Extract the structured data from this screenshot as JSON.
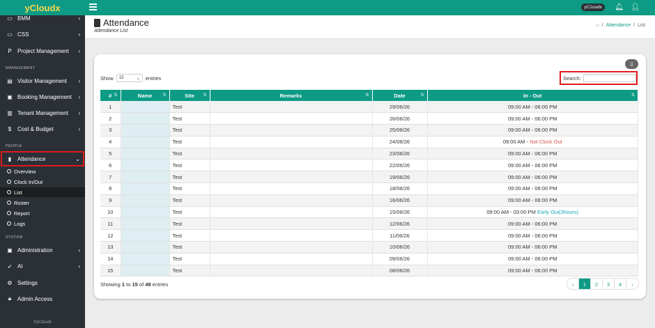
{
  "brand": "yCloudx",
  "sidebar": {
    "top_items": [
      {
        "label": "BMM",
        "icon": "monitor-icon"
      },
      {
        "label": "CSS",
        "icon": "monitor-icon"
      },
      {
        "label": "Project Management",
        "icon": "p-icon"
      }
    ],
    "management_label": "MANAGEMENT",
    "management_items": [
      {
        "label": "Visitor Management",
        "icon": "id-card-icon"
      },
      {
        "label": "Booking Management",
        "icon": "briefcase-icon"
      },
      {
        "label": "Tenant Management",
        "icon": "tenant-icon"
      },
      {
        "label": "Cost & Budget",
        "icon": "dollar-icon"
      }
    ],
    "people_label": "PEOPLE",
    "attendance_label": "Attendance",
    "attendance_sub": [
      "Overview",
      "Clock In/Out",
      "List",
      "Roster",
      "Report",
      "Logs"
    ],
    "system_label": "SYSTEM",
    "system_items": [
      {
        "label": "Administration",
        "icon": "briefcase-icon"
      },
      {
        "label": "AI",
        "icon": "rocket-icon"
      },
      {
        "label": "Settings",
        "icon": "gear-icon"
      },
      {
        "label": "Admin Access",
        "icon": "lock-icon"
      }
    ],
    "footer": "©yCloudx"
  },
  "topbar": {
    "user": "yC1oudx"
  },
  "header": {
    "title": "Attendance",
    "subtitle": "Attendance List",
    "breadcrumb": [
      "Attendance",
      "List"
    ]
  },
  "controls": {
    "show_label": "Show",
    "page_size": "15",
    "entries_label": "entries",
    "search_label": "Search:"
  },
  "table": {
    "columns": [
      "#",
      "Name",
      "Site",
      "Remarks",
      "Date",
      "In - Out"
    ],
    "rows": [
      {
        "n": "1",
        "site": "Test",
        "date": "29/06/26",
        "time": "09:00 AM - 06:00 PM",
        "note": ""
      },
      {
        "n": "2",
        "site": "Test",
        "date": "26/06/26",
        "time": "09:00 AM - 06:00 PM",
        "note": ""
      },
      {
        "n": "3",
        "site": "Test",
        "date": "25/06/26",
        "time": "09:00 AM - 06:00 PM",
        "note": ""
      },
      {
        "n": "4",
        "site": "Test",
        "date": "24/06/26",
        "time": "09:00 AM - ",
        "note": "Not Clock Out",
        "note_color": "red"
      },
      {
        "n": "5",
        "site": "Test",
        "date": "23/06/26",
        "time": "09:00 AM - 06:00 PM",
        "note": ""
      },
      {
        "n": "6",
        "site": "Test",
        "date": "22/06/26",
        "time": "09:00 AM - 06:00 PM",
        "note": ""
      },
      {
        "n": "7",
        "site": "Test",
        "date": "19/06/26",
        "time": "09:00 AM - 06:00 PM",
        "note": ""
      },
      {
        "n": "8",
        "site": "Test",
        "date": "18/06/26",
        "time": "09:00 AM - 08:00 PM",
        "note": ""
      },
      {
        "n": "9",
        "site": "Test",
        "date": "16/06/26",
        "time": "09:00 AM - 06:00 PM",
        "note": ""
      },
      {
        "n": "10",
        "site": "Test",
        "date": "15/06/26",
        "time": "09:00 AM - 03:00 PM ",
        "note": "Early Out(3hours)",
        "note_color": "teal"
      },
      {
        "n": "11",
        "site": "Test",
        "date": "12/06/26",
        "time": "09:00 AM - 06:00 PM",
        "note": ""
      },
      {
        "n": "12",
        "site": "Test",
        "date": "11/06/26",
        "time": "09:00 AM - 06:00 PM",
        "note": ""
      },
      {
        "n": "13",
        "site": "Test",
        "date": "10/06/26",
        "time": "09:00 AM - 06:00 PM",
        "note": ""
      },
      {
        "n": "14",
        "site": "Test",
        "date": "09/06/26",
        "time": "09:00 AM - 06:00 PM",
        "note": ""
      },
      {
        "n": "15",
        "site": "Test",
        "date": "08/06/26",
        "time": "09:00 AM - 06:00 PM",
        "note": ""
      }
    ]
  },
  "footer_info": {
    "prefix": "Showing ",
    "from": "1",
    "to_word": " to ",
    "to": "15",
    "of_word": " of ",
    "total": "48",
    "suffix": " entries"
  },
  "pagination": {
    "pages": [
      "1",
      "2",
      "3",
      "4"
    ],
    "active": "1",
    "prev": "‹",
    "next": "›"
  },
  "colors": {
    "accent": "#0d9b85",
    "sidebar": "#2a3036",
    "highlight": "#e01b1b",
    "warn": "#d9534f",
    "info": "#1aa3b8"
  }
}
